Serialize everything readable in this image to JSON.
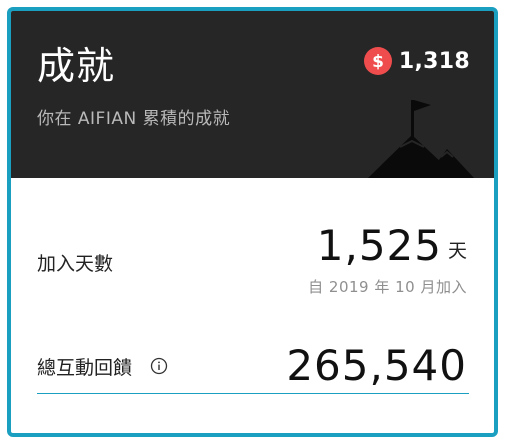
{
  "header": {
    "title": "成就",
    "subtitle": "你在 AIFIAN 累積的成就",
    "points": "1,318",
    "coin_icon": "dollar-coin-icon",
    "decoration_icon": "mountain-flag-icon"
  },
  "days_joined": {
    "label": "加入天數",
    "value": "1,525",
    "unit": "天",
    "since": "自 2019 年 10 月加入"
  },
  "interactions": {
    "label": "總互動回饋",
    "info_icon": "info-circle-icon",
    "value": "265,540"
  },
  "colors": {
    "frame": "#1a9fc0",
    "header_bg": "#262626",
    "coin": "#ef4d4d",
    "divider": "#1a9fc0"
  }
}
